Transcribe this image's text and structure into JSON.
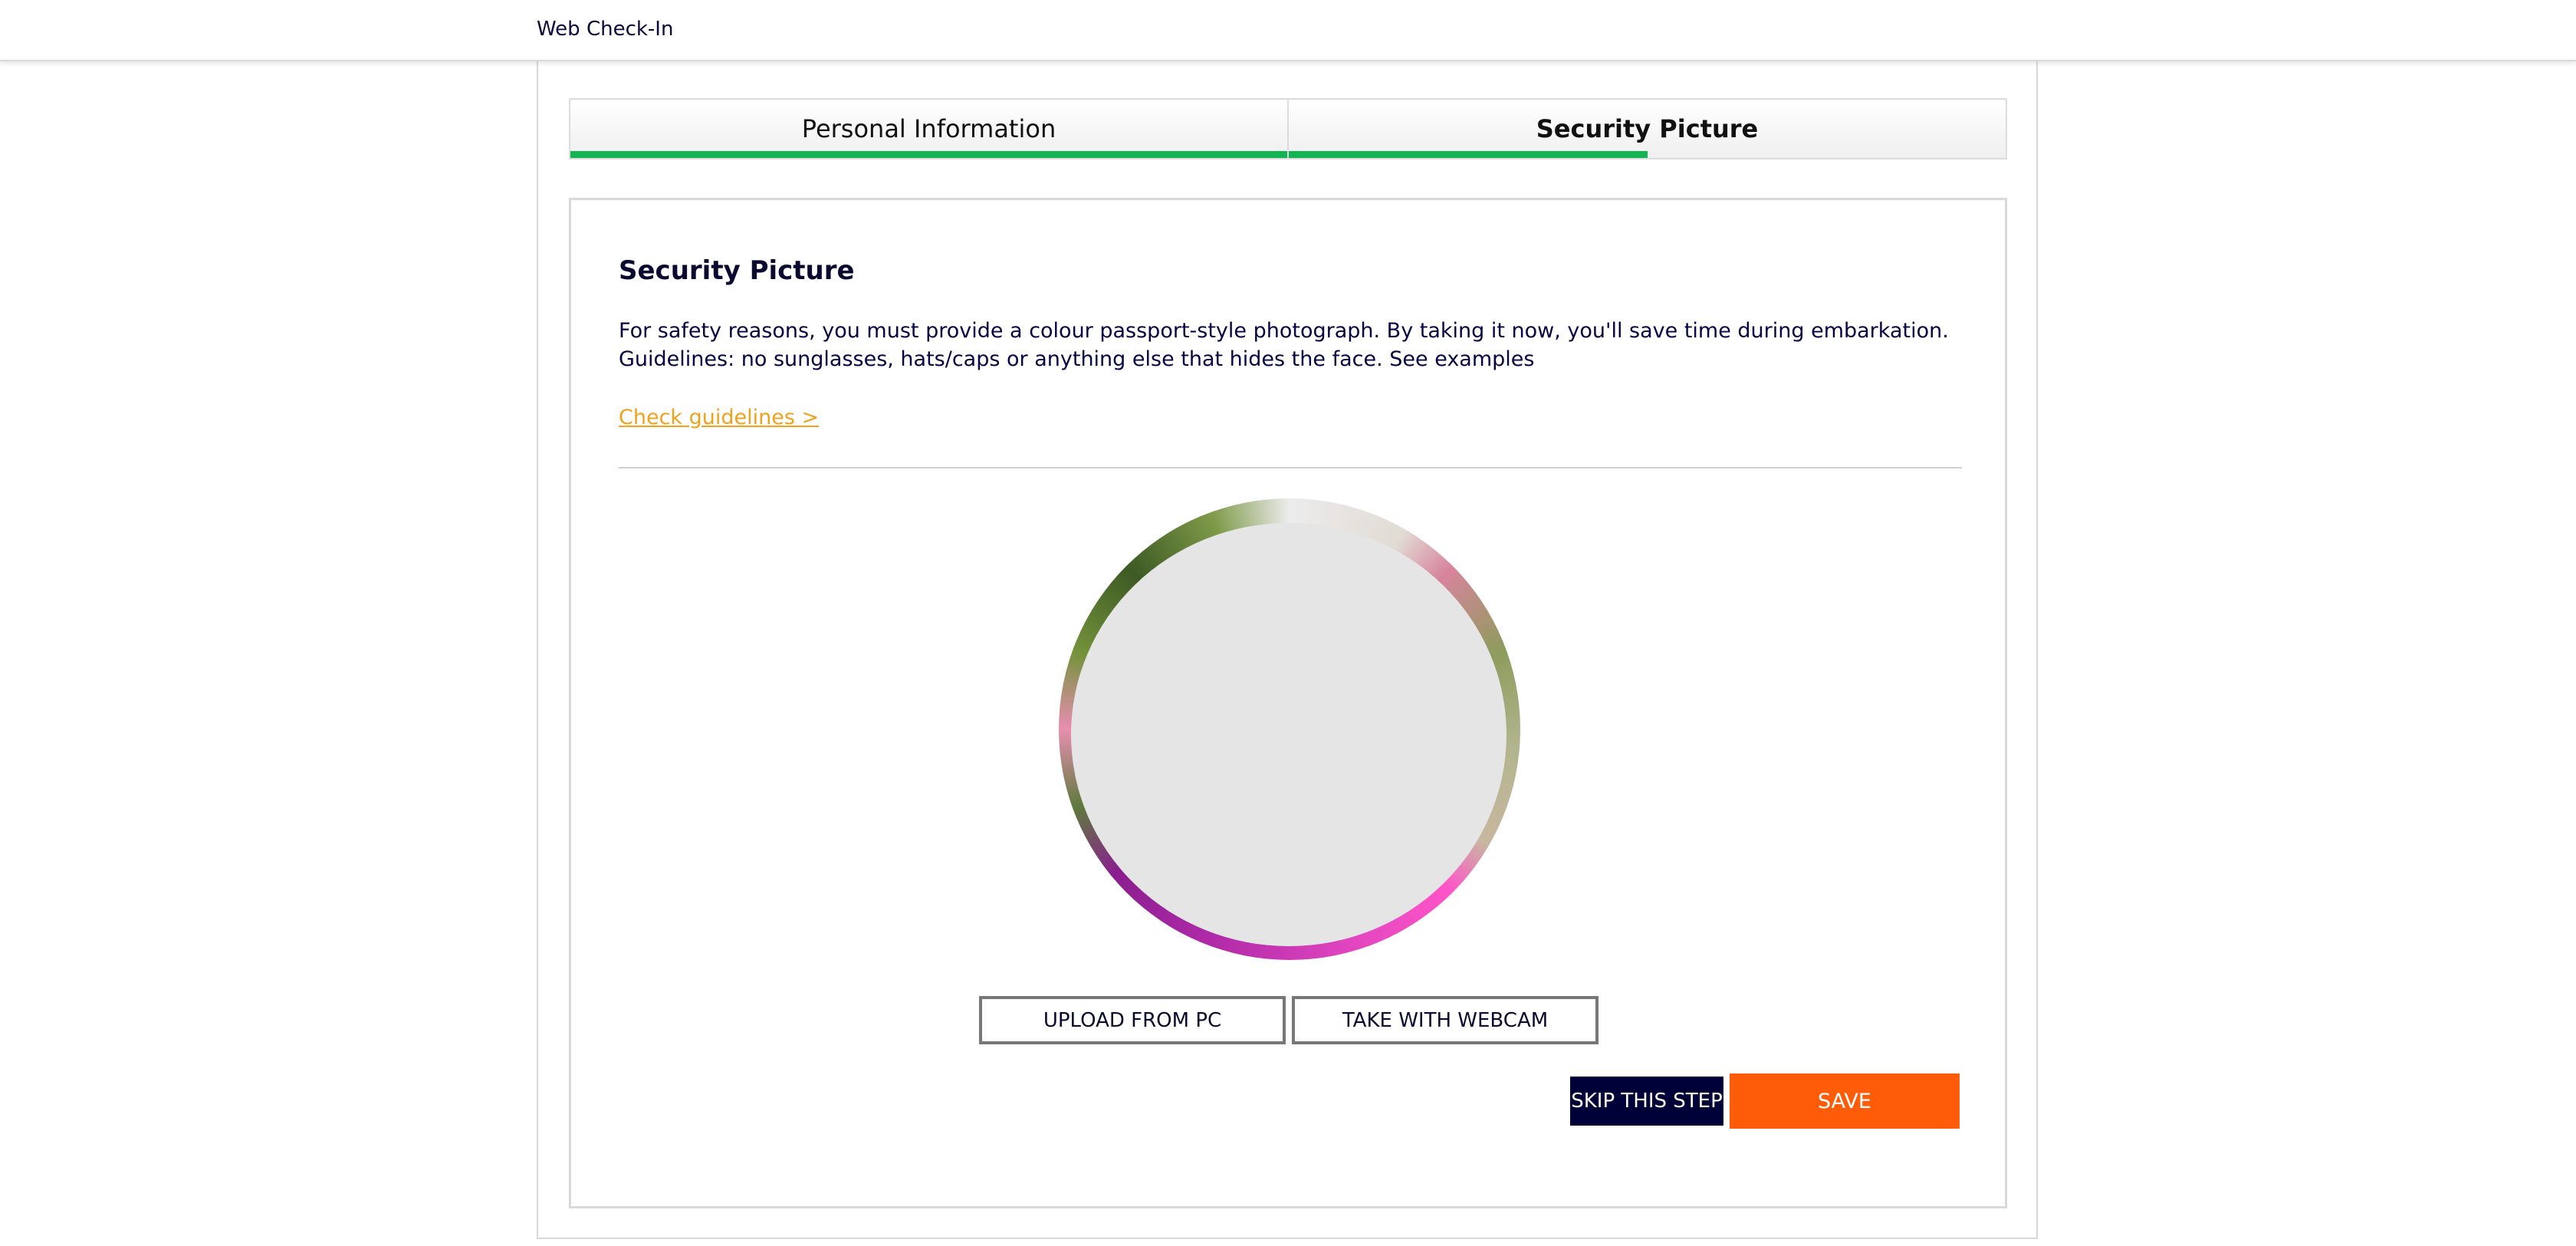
{
  "header": {
    "title": "Web Check-In"
  },
  "tabs": [
    {
      "label": "Personal Information",
      "progress_percent": 100,
      "active": false
    },
    {
      "label": "Security Picture",
      "progress_percent": 50,
      "active": true
    }
  ],
  "section": {
    "title": "Security Picture",
    "description": "For safety reasons, you must provide a colour passport-style photograph. By taking it now, you'll save time during embarkation. Guidelines: no sunglasses, hats/caps or anything else that hides the face. See examples",
    "guidelines_link": "Check guidelines >"
  },
  "photo": {
    "icon": "profile-photo-placeholder"
  },
  "buttons": {
    "upload": "UPLOAD FROM PC",
    "webcam": "TAKE WITH WEBCAM",
    "skip": "SKIP THIS STEP",
    "save": "SAVE"
  },
  "colors": {
    "progress": "#12b350",
    "link": "#f0a21c",
    "skip_button": "#000038",
    "save_button": "#ff5c0a",
    "text": "#050536"
  }
}
